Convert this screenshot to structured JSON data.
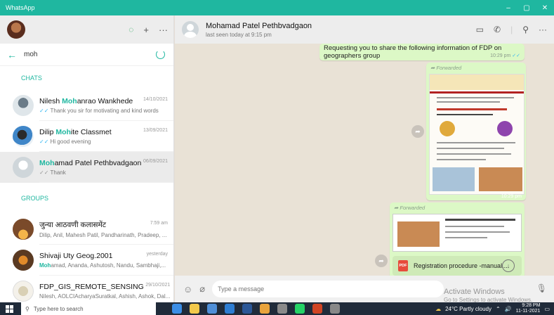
{
  "window": {
    "title": "WhatsApp",
    "controls": [
      "–",
      "▢",
      "✕"
    ]
  },
  "left": {
    "search": {
      "value": "moh"
    },
    "chats_label": "CHATS",
    "groups_label": "GROUPS",
    "chats": [
      {
        "name_highlight": "",
        "name_pre": "Nilesh ",
        "name_mid": "Moh",
        "name_post": "anrao Wankhede",
        "time": "14/10/2021",
        "preview": "Thank you sir for motivating and kind words"
      },
      {
        "name_pre": "Dilip ",
        "name_mid": "Moh",
        "name_post": "ite Classmet",
        "time": "13/09/2021",
        "preview": "Hi good evening"
      },
      {
        "name_pre": "",
        "name_mid": "Moh",
        "name_post": "amad Patel Pethbvadgaon",
        "time": "06/09/2021",
        "preview": "Thank"
      }
    ],
    "groups": [
      {
        "name": "जुन्या आठवणी कलासमेंट",
        "time": "7:59 am",
        "preview": "Dilip, Anil, Mahesh Patil, Pandharinath, Pradeep, ..."
      },
      {
        "name": "Shivaji Uty Geog.2001",
        "time": "yesterday",
        "preview_hl": "Moh",
        "preview": "amad, Ananda, Ashutosh, Nandu, Sambhaji,..."
      },
      {
        "name": "FDP_GIS_REMOTE_SENSING",
        "time": "29/10/2021",
        "preview": "Nilesh, AOLCIAcharyaSuratkal, Ashish, Ashok, Dal..."
      }
    ]
  },
  "conversation": {
    "contact_name": "Mohamad Patel Pethbvadgaon",
    "contact_status": "last seen today at 9:15 pm",
    "message1": {
      "text": "Requesting you to share the following information of FDP on geographers group",
      "time": "10:29 pm"
    },
    "message2": {
      "label": "Forwarded",
      "time": "10:29 pm"
    },
    "message3": {
      "label": "Forwarded",
      "document": "Registration procedure -manual..."
    },
    "composer_placeholder": "Type a message"
  },
  "watermark": {
    "line1": "Activate Windows",
    "line2": "Go to Settings to activate Windows."
  },
  "taskbar": {
    "search_placeholder": "Type here to search",
    "weather": "24°C  Partly cloudy",
    "time": "9:28 PM",
    "date": "11-11-2021"
  },
  "colors": {
    "accent": "#1fb7a0",
    "bubble": "#dcf8c6",
    "taskbar": "#202b3a"
  }
}
